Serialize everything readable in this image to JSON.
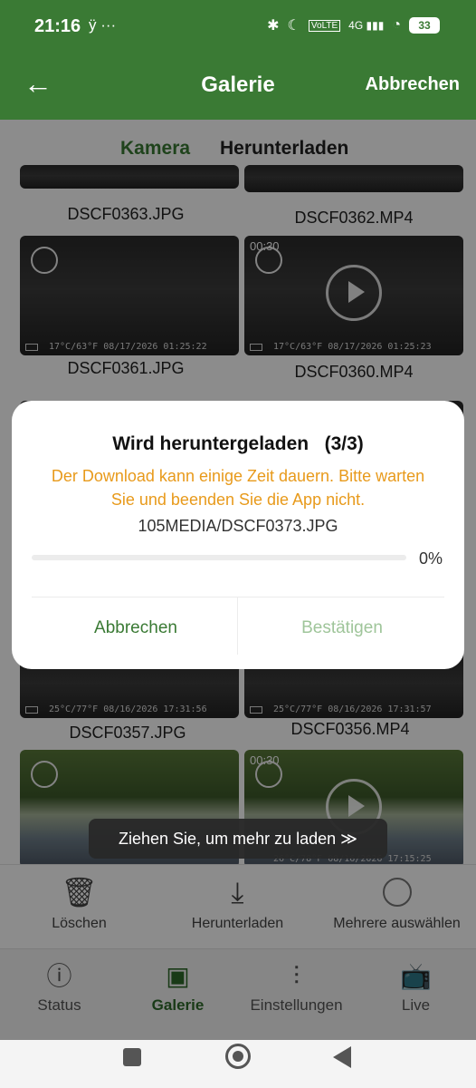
{
  "status_bar": {
    "time": "21:16",
    "left_icons": "ÿ ···",
    "right_icons": [
      "✱",
      "☾",
      "VoLTE",
      "4G ▮▮▮",
      "◔"
    ],
    "battery": "33"
  },
  "header": {
    "back_icon": "←",
    "title": "Galerie",
    "action": "Abbrechen"
  },
  "tabs": [
    {
      "label": "Kamera",
      "active": true
    },
    {
      "label": "Herunterladen",
      "active": false
    }
  ],
  "gallery": {
    "top_names": [
      "DSCF0363.JPG",
      "DSCF0362.MP4"
    ],
    "items": [
      {
        "name": "DSCF0361.JPG",
        "stamp": "17°C/63°F 08/17/2026 01:25:22",
        "video": false,
        "duration": ""
      },
      {
        "name": "DSCF0360.MP4",
        "stamp": "17°C/63°F 08/17/2026 01:25:23",
        "video": true,
        "duration": "00:30"
      },
      {
        "name": "DSCF0357.JPG",
        "stamp": "25°C/77°F 08/16/2026 17:31:56",
        "video": false,
        "duration": ""
      },
      {
        "name": "DSCF0356.MP4",
        "stamp": "25°C/77°F 08/16/2026 17:31:57",
        "video": true,
        "duration": ""
      },
      {
        "name": "",
        "stamp": "",
        "video": false,
        "duration": ""
      },
      {
        "name": "",
        "stamp": "26°C/78°F 08/16/2026 17:15:25",
        "video": true,
        "duration": "00:30"
      }
    ]
  },
  "pull_hint": "Ziehen Sie, um mehr zu laden ≫",
  "toolbar": [
    {
      "icon": "trash-icon",
      "glyph": "🗑",
      "label": "Löschen"
    },
    {
      "icon": "download-icon",
      "glyph": "⤓",
      "label": "Herunterladen"
    },
    {
      "icon": "select-circle-icon",
      "glyph": "",
      "label": "Mehrere auswählen"
    }
  ],
  "bottom_nav": [
    {
      "icon": "info-icon",
      "glyph": "ⓘ",
      "label": "Status",
      "active": false
    },
    {
      "icon": "gallery-icon",
      "glyph": "▣",
      "label": "Galerie",
      "active": true
    },
    {
      "icon": "settings-sliders-icon",
      "glyph": "⫶",
      "label": "Einstellungen",
      "active": false
    },
    {
      "icon": "live-tv-icon",
      "glyph": "📺",
      "label": "Live",
      "active": false
    }
  ],
  "dialog": {
    "title": "Wird heruntergeladen   (3/3)",
    "message": "Der Download kann einige Zeit dauern. Bitte warten Sie und beenden Sie die App nicht.",
    "file_path": "105MEDIA/DSCF0373.JPG",
    "progress": 0,
    "progress_label": "0%",
    "cancel_label": "Abbrechen",
    "confirm_label": "Bestätigen"
  },
  "colors": {
    "primary": "#3a7a34",
    "warning_text": "#e89a1b",
    "disabled_confirm": "#9fc59a"
  }
}
